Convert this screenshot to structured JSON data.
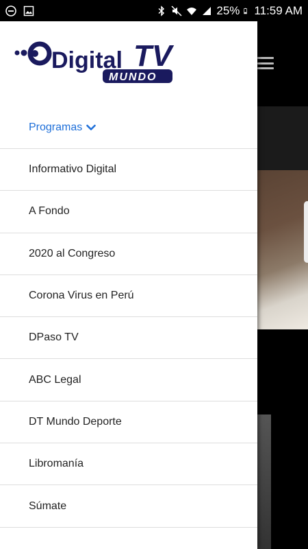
{
  "status_bar": {
    "battery": "25%",
    "time": "11:59 AM"
  },
  "drawer": {
    "logo": {
      "main": "Digital",
      "accent": "TV",
      "sub": "MUNDO"
    },
    "section_label": "Programas",
    "items": [
      {
        "label": "Informativo Digital"
      },
      {
        "label": "A Fondo"
      },
      {
        "label": "2020 al Congreso"
      },
      {
        "label": "Corona Virus en Perú"
      },
      {
        "label": "DPaso TV"
      },
      {
        "label": "ABC Legal"
      },
      {
        "label": "DT Mundo Deporte"
      },
      {
        "label": "Libromanía"
      },
      {
        "label": "Súmate"
      }
    ]
  },
  "colors": {
    "accent": "#1e6fd9",
    "logo_navy": "#1a1a5e"
  }
}
